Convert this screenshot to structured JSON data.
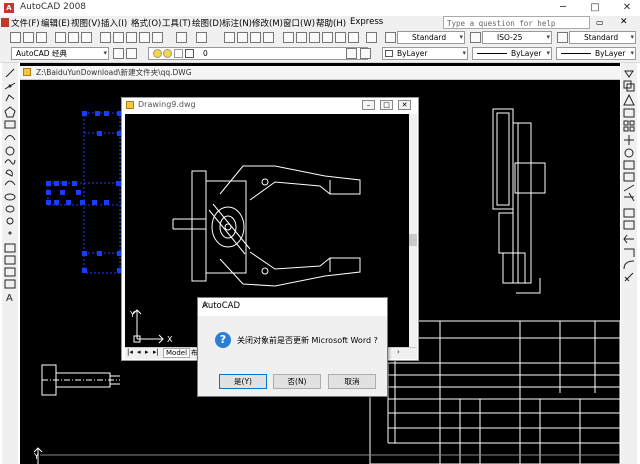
{
  "window": {
    "title": "AutoCAD 2008",
    "minimize": "─",
    "maximize": "□",
    "close": "✕"
  },
  "menu": [
    "文件(F)",
    "编辑(E)",
    "视图(V)",
    "插入(I)",
    "格式(O)",
    "工具(T)",
    "绘图(D)",
    "标注(N)",
    "修改(M)",
    "窗口(W)",
    "帮助(H)",
    "Express"
  ],
  "help_search": {
    "placeholder": "Type a question for help"
  },
  "toolbar": {
    "workspace": "AutoCAD 经典",
    "layer_value": "0",
    "text_style": "Standard",
    "dim_style": "ISO-25",
    "table_style": "Standard",
    "color": "ByLayer",
    "linetype": "ByLayer",
    "lineweight": "ByLayer"
  },
  "document": {
    "path": "Z:\\BaiduYunDownload\\新建文件夹\\qq.DWG"
  },
  "drawing_window": {
    "title": "Drawing9.dwg",
    "tab_model": "Model",
    "tab_layout": "布",
    "ucs_x": "X",
    "ucs_y": "Y",
    "nav_first": "|◂",
    "nav_prev": "◂",
    "nav_next": "▸",
    "nav_last": "▸|"
  },
  "dialog": {
    "title": "AutoCAD",
    "close": "✕",
    "message": "关闭对象前是否更新 Microsoft Word ?",
    "yes": "是(Y)",
    "no": "否(N)",
    "cancel": "取消"
  },
  "model_ucs": {
    "y": "Y"
  },
  "colors": {
    "canvas": "#000000",
    "selection": "#1a3cff",
    "accent": "#2a7fd4"
  }
}
